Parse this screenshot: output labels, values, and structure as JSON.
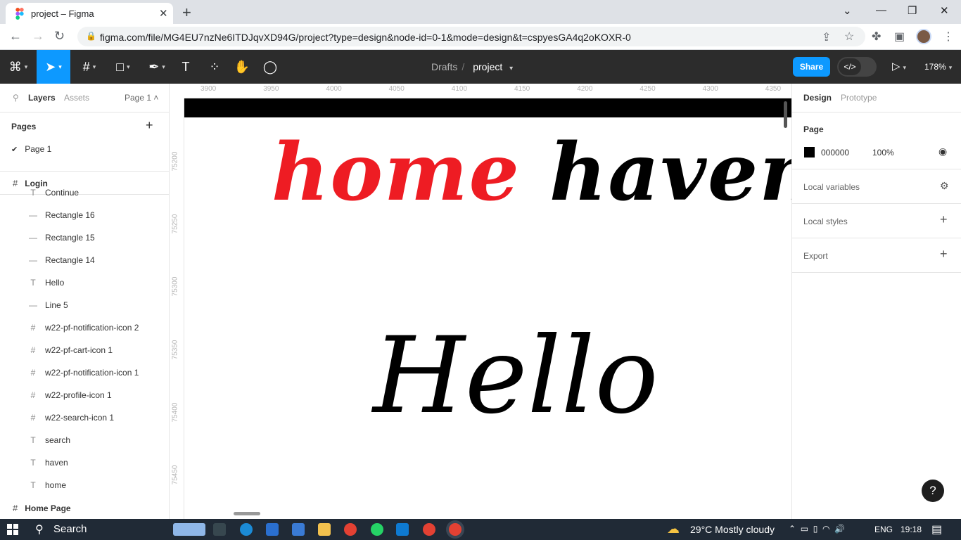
{
  "browser": {
    "tab_title": "project – Figma",
    "tab_close": "✕",
    "new_tab": "+",
    "url": "figma.com/file/MG4EU7nzNe6ITDJqvXD94G/project?type=design&node-id=0-1&mode=design&t=cspyesGA4q2oKOXR-0"
  },
  "toolbar": {
    "breadcrumb_drafts": "Drafts",
    "breadcrumb_sep": "/",
    "breadcrumb_project": "project",
    "share_label": "Share",
    "devmode_label": "</>",
    "zoom": "178%"
  },
  "left_panel": {
    "tab_layers": "Layers",
    "tab_assets": "Assets",
    "page_selector": "Page 1 ˄",
    "pages_header": "Pages",
    "pages_add": "+",
    "current_page": "Page 1",
    "frames": {
      "login": "Login",
      "home_page": "Home Page"
    },
    "layers": [
      {
        "name": "Continue",
        "icon": "text-icon"
      },
      {
        "name": "Rectangle 16",
        "icon": "rectangle-icon"
      },
      {
        "name": "Rectangle 15",
        "icon": "rectangle-icon"
      },
      {
        "name": "Rectangle 14",
        "icon": "rectangle-icon"
      },
      {
        "name": "Hello",
        "icon": "text-icon"
      },
      {
        "name": "Line 5",
        "icon": "line-icon"
      },
      {
        "name": "w22-pf-notification-icon 2",
        "icon": "frame-icon"
      },
      {
        "name": "w22-pf-cart-icon 1",
        "icon": "frame-icon"
      },
      {
        "name": "w22-pf-notification-icon 1",
        "icon": "frame-icon"
      },
      {
        "name": "w22-profile-icon 1",
        "icon": "frame-icon"
      },
      {
        "name": "w22-search-icon 1",
        "icon": "frame-icon"
      },
      {
        "name": "search",
        "icon": "text-icon"
      },
      {
        "name": "haven",
        "icon": "text-icon"
      },
      {
        "name": "home",
        "icon": "text-icon"
      }
    ]
  },
  "canvas": {
    "ruler_x": [
      "3900",
      "3950",
      "4000",
      "4050",
      "4100",
      "4150",
      "4200",
      "4250",
      "4300",
      "4350"
    ],
    "ruler_y": [
      "75200",
      "75250",
      "75300",
      "75350",
      "75400",
      "75450"
    ],
    "brand_home": "home",
    "brand_haven": "haven",
    "hello": "Hello",
    "colors": {
      "home": "#ee1c23",
      "haven": "#000000",
      "bar": "#000000"
    }
  },
  "right_panel": {
    "tab_design": "Design",
    "tab_prototype": "Prototype",
    "page_section": "Page",
    "page_color_hex": "000000",
    "page_opacity": "100%",
    "local_variables": "Local variables",
    "local_styles": "Local styles",
    "export": "Export",
    "help": "?"
  },
  "taskbar": {
    "search": "Search",
    "weather": "29°C  Mostly cloudy",
    "language": "ENG",
    "time": "19:18"
  }
}
